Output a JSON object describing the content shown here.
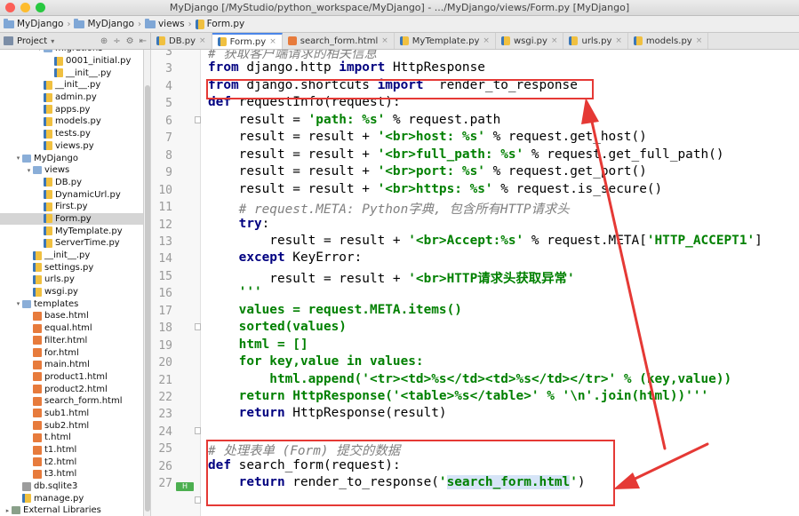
{
  "window": {
    "title": "MyDjango [/MyStudio/python_workspace/MyDjango] - .../MyDjango/views/Form.py [MyDjango]"
  },
  "breadcrumbs": [
    "MyDjango",
    "MyDjango",
    "views",
    "Form.py"
  ],
  "toolwindow": {
    "project_label": "Project"
  },
  "tabs": [
    {
      "label": "DB.py",
      "active": false,
      "type": "py"
    },
    {
      "label": "Form.py",
      "active": true,
      "type": "py"
    },
    {
      "label": "search_form.html",
      "active": false,
      "type": "html"
    },
    {
      "label": "MyTemplate.py",
      "active": false,
      "type": "py"
    },
    {
      "label": "wsgi.py",
      "active": false,
      "type": "py"
    },
    {
      "label": "urls.py",
      "active": false,
      "type": "py"
    },
    {
      "label": "models.py",
      "active": false,
      "type": "py"
    }
  ],
  "tree": [
    {
      "label": "migrations",
      "indent": 3,
      "icon": "folder",
      "arrow": "▾"
    },
    {
      "label": "0001_initial.py",
      "indent": 4,
      "icon": "py"
    },
    {
      "label": "__init__.py",
      "indent": 4,
      "icon": "py"
    },
    {
      "label": "__init__.py",
      "indent": 3,
      "icon": "py"
    },
    {
      "label": "admin.py",
      "indent": 3,
      "icon": "py"
    },
    {
      "label": "apps.py",
      "indent": 3,
      "icon": "py"
    },
    {
      "label": "models.py",
      "indent": 3,
      "icon": "py"
    },
    {
      "label": "tests.py",
      "indent": 3,
      "icon": "py"
    },
    {
      "label": "views.py",
      "indent": 3,
      "icon": "py"
    },
    {
      "label": "MyDjango",
      "indent": 1,
      "icon": "folder",
      "arrow": "▾"
    },
    {
      "label": "views",
      "indent": 2,
      "icon": "folder",
      "arrow": "▾"
    },
    {
      "label": "DB.py",
      "indent": 3,
      "icon": "py"
    },
    {
      "label": "DynamicUrl.py",
      "indent": 3,
      "icon": "py"
    },
    {
      "label": "First.py",
      "indent": 3,
      "icon": "py"
    },
    {
      "label": "Form.py",
      "indent": 3,
      "icon": "py",
      "selected": true
    },
    {
      "label": "MyTemplate.py",
      "indent": 3,
      "icon": "py"
    },
    {
      "label": "ServerTime.py",
      "indent": 3,
      "icon": "py"
    },
    {
      "label": "__init__.py",
      "indent": 2,
      "icon": "py"
    },
    {
      "label": "settings.py",
      "indent": 2,
      "icon": "py"
    },
    {
      "label": "urls.py",
      "indent": 2,
      "icon": "py"
    },
    {
      "label": "wsgi.py",
      "indent": 2,
      "icon": "py"
    },
    {
      "label": "templates",
      "indent": 1,
      "icon": "folder",
      "arrow": "▾"
    },
    {
      "label": "base.html",
      "indent": 2,
      "icon": "html"
    },
    {
      "label": "equal.html",
      "indent": 2,
      "icon": "html"
    },
    {
      "label": "filter.html",
      "indent": 2,
      "icon": "html"
    },
    {
      "label": "for.html",
      "indent": 2,
      "icon": "html"
    },
    {
      "label": "main.html",
      "indent": 2,
      "icon": "html"
    },
    {
      "label": "product1.html",
      "indent": 2,
      "icon": "html"
    },
    {
      "label": "product2.html",
      "indent": 2,
      "icon": "html"
    },
    {
      "label": "search_form.html",
      "indent": 2,
      "icon": "html"
    },
    {
      "label": "sub1.html",
      "indent": 2,
      "icon": "html"
    },
    {
      "label": "sub2.html",
      "indent": 2,
      "icon": "html"
    },
    {
      "label": "t.html",
      "indent": 2,
      "icon": "html"
    },
    {
      "label": "t1.html",
      "indent": 2,
      "icon": "html"
    },
    {
      "label": "t2.html",
      "indent": 2,
      "icon": "html"
    },
    {
      "label": "t3.html",
      "indent": 2,
      "icon": "html"
    },
    {
      "label": "db.sqlite3",
      "indent": 1,
      "icon": "db"
    },
    {
      "label": "manage.py",
      "indent": 1,
      "icon": "py"
    },
    {
      "label": "External Libraries",
      "indent": 0,
      "icon": "lib",
      "arrow": "▸"
    }
  ],
  "code_lines": [
    {
      "n": "3",
      "tokens": [
        {
          "t": "# 获取客户端请求的相关信息",
          "c": "cmt"
        }
      ]
    },
    {
      "n": "3",
      "tokens": [
        {
          "t": "from",
          "c": "kw"
        },
        {
          "t": " django.http "
        },
        {
          "t": "import",
          "c": "kw"
        },
        {
          "t": " HttpResponse"
        }
      ]
    },
    {
      "n": "4",
      "tokens": [
        {
          "t": "from",
          "c": "kw"
        },
        {
          "t": " django.shortcuts "
        },
        {
          "t": "import",
          "c": "kw"
        },
        {
          "t": "  render_to_response"
        }
      ]
    },
    {
      "n": "5",
      "tokens": [
        {
          "t": "def",
          "c": "kw"
        },
        {
          "t": " requestInfo(request):"
        }
      ]
    },
    {
      "n": "6",
      "tokens": [
        {
          "t": "    result = "
        },
        {
          "t": "'path: %s'",
          "c": "str"
        },
        {
          "t": " % request.path"
        }
      ]
    },
    {
      "n": "7",
      "tokens": [
        {
          "t": "    result = result + "
        },
        {
          "t": "'<br>host: %s'",
          "c": "str"
        },
        {
          "t": " % request.get_host()"
        }
      ]
    },
    {
      "n": "8",
      "tokens": [
        {
          "t": "    result = result + "
        },
        {
          "t": "'<br>full_path: %s'",
          "c": "str"
        },
        {
          "t": " % request.get_full_path()"
        }
      ]
    },
    {
      "n": "9",
      "tokens": [
        {
          "t": "    result = result + "
        },
        {
          "t": "'<br>port: %s'",
          "c": "str"
        },
        {
          "t": " % request.get_port()"
        }
      ]
    },
    {
      "n": "10",
      "tokens": [
        {
          "t": "    result = result + "
        },
        {
          "t": "'<br>https: %s'",
          "c": "str"
        },
        {
          "t": " % request.is_secure()"
        }
      ]
    },
    {
      "n": "11",
      "tokens": [
        {
          "t": "    # request.META: Python字典, 包含所有HTTP请求头",
          "c": "cmt"
        }
      ]
    },
    {
      "n": "12",
      "tokens": [
        {
          "t": "    "
        },
        {
          "t": "try",
          "c": "kw"
        },
        {
          "t": ":"
        }
      ]
    },
    {
      "n": "13",
      "tokens": [
        {
          "t": "        result = result + "
        },
        {
          "t": "'<br>Accept:%s'",
          "c": "str"
        },
        {
          "t": " % request.META["
        },
        {
          "t": "'HTTP_ACCEPT1'",
          "c": "str"
        },
        {
          "t": "]"
        }
      ]
    },
    {
      "n": "14",
      "tokens": [
        {
          "t": "    "
        },
        {
          "t": "except",
          "c": "kw"
        },
        {
          "t": " KeyError:"
        }
      ]
    },
    {
      "n": "15",
      "tokens": [
        {
          "t": "        result = result + "
        },
        {
          "t": "'<br>HTTP请求头获取异常'",
          "c": "str"
        }
      ]
    },
    {
      "n": "16",
      "tokens": [
        {
          "t": "    '''",
          "c": "str"
        }
      ]
    },
    {
      "n": "17",
      "tokens": [
        {
          "t": "    values = request.META.items()",
          "c": "str"
        }
      ]
    },
    {
      "n": "18",
      "tokens": [
        {
          "t": "    sorted(values)",
          "c": "str"
        }
      ]
    },
    {
      "n": "19",
      "tokens": [
        {
          "t": "    html = []",
          "c": "str"
        }
      ]
    },
    {
      "n": "20",
      "tokens": [
        {
          "t": "    for key,value in values:",
          "c": "str"
        }
      ]
    },
    {
      "n": "21",
      "tokens": [
        {
          "t": "        html.append('<tr><td>%s</td><td>%s</td></tr>' % (key,value))",
          "c": "str"
        }
      ]
    },
    {
      "n": "22",
      "tokens": [
        {
          "t": "    return HttpResponse('<table>%s</table>' % '\\n'.join(html))'''",
          "c": "str"
        }
      ]
    },
    {
      "n": "23",
      "tokens": [
        {
          "t": "    "
        },
        {
          "t": "return",
          "c": "kw"
        },
        {
          "t": " HttpResponse(result)"
        }
      ]
    },
    {
      "n": "24",
      "tokens": [
        {
          "t": ""
        }
      ]
    },
    {
      "n": "25",
      "tokens": [
        {
          "t": "# 处理表单 (Form) 提交的数据",
          "c": "cmt"
        }
      ]
    },
    {
      "n": "26",
      "tokens": [
        {
          "t": "def",
          "c": "kw"
        },
        {
          "t": " search_form(request):"
        }
      ]
    },
    {
      "n": "27",
      "tokens": [
        {
          "t": "    "
        },
        {
          "t": "return",
          "c": "kw"
        },
        {
          "t": " render_to_response("
        },
        {
          "t": "'",
          "c": "str"
        },
        {
          "t": "search_form.html",
          "c": "str sel"
        },
        {
          "t": "'",
          "c": "str"
        },
        {
          "t": ")"
        }
      ]
    }
  ],
  "colors": {
    "annotation": "#e53935",
    "keyword": "#000080",
    "string": "#008000",
    "comment": "#808080"
  }
}
